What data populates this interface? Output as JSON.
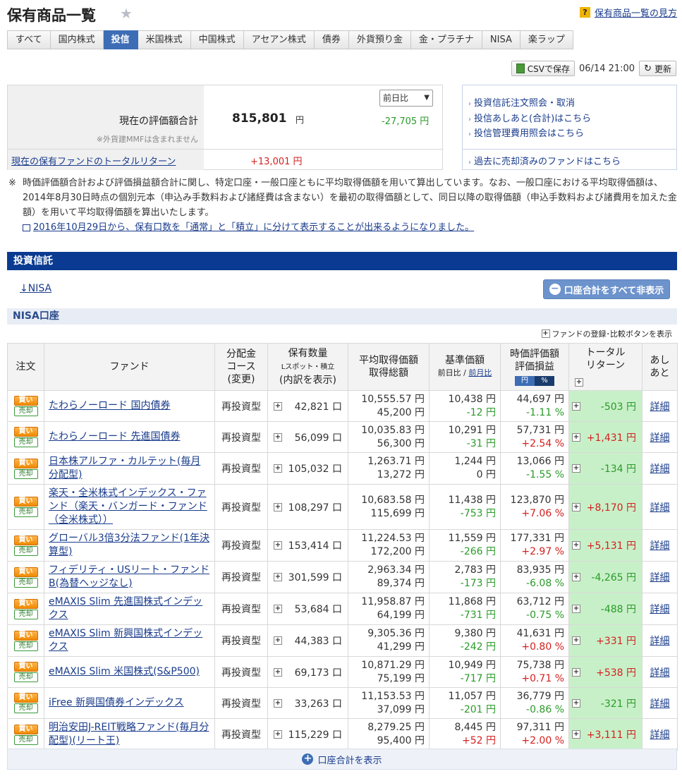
{
  "header": {
    "title": "保有商品一覧",
    "help_link": "保有商品一覧の見方"
  },
  "tabs": [
    {
      "label": "すべて"
    },
    {
      "label": "国内株式"
    },
    {
      "label": "投信"
    },
    {
      "label": "米国株式"
    },
    {
      "label": "中国株式"
    },
    {
      "label": "アセアン株式"
    },
    {
      "label": "債券"
    },
    {
      "label": "外貨預り金"
    },
    {
      "label": "金・プラチナ"
    },
    {
      "label": "NISA"
    },
    {
      "label": "楽ラップ"
    }
  ],
  "active_tab": "投信",
  "toolbar": {
    "csv_label": "CSVで保存",
    "timestamp": "06/14 21:00",
    "refresh_label": "更新"
  },
  "summary": {
    "valuation_label": "現在の評価額合計",
    "valuation_note": "※外貨建MMFは含まれません",
    "valuation_amount": "815,801",
    "yen": "円",
    "compare_select": "前日比",
    "diff": "-27,705 円",
    "total_return_label": "現在の保有ファンドのトータルリターン",
    "total_return_value": "+13,001 円"
  },
  "side_links": {
    "link1": "投資信託注文照会・取消",
    "link2": "投信あしあと(合計)はこちら",
    "link3": "投信管理費用照会はこちら",
    "link4": "過去に売却済みのファンドはこちら"
  },
  "notes": {
    "mark": "※",
    "text": "時価評価額合計および評価損益額合計に関し、特定口座・一般口座ともに平均取得価額を用いて算出しています。なお、一般口座における平均取得価額は、2014年8月30日時点の個別元本（申込み手数料および諸経費は含まない）を最初の取得価額として、同日以降の取得価額（申込手数料および諸費用を加えた金額）を用いて平均取得価額を算出いたします。",
    "news_link": "2016年10月29日から、保有口数を「通常」と「積立」に分けて表示することが出来るようになりました。"
  },
  "section": {
    "title": "投資信託",
    "nisa_anchor": "↓NISA",
    "hide_button": "口座合計をすべて非表示",
    "subsection": "NISA口座",
    "fund_register": "ファンドの登録･比較ボタンを表示"
  },
  "table": {
    "headers": {
      "order": "注文",
      "fund": "ファンド",
      "course_l1": "分配金",
      "course_l2": "コース",
      "course_l3": "(変更)",
      "qty_l1": "保有数量",
      "qty_l2": "Lスポット・積立",
      "qty_l3": "(内訳を表示)",
      "avg_l1": "平均取得価額",
      "avg_l2": "取得総額",
      "base_l1": "基準価額",
      "base_l2a": "前日比",
      "base_l2b": "前月比",
      "val_l1": "時価評価額",
      "val_l2": "評価損益",
      "toggle_yen": "円",
      "toggle_pct": "%",
      "ret_l1": "トータル",
      "ret_l2": "リターン",
      "ash_l1": "あし",
      "ash_l2": "あと"
    },
    "buy_label": "買い",
    "sell_label": "売却",
    "detail_label": "詳細",
    "rows": [
      {
        "fund": "たわらノーロード 国内債券",
        "course": "再投資型",
        "qty": "42,821 口",
        "avg": "10,555.57 円",
        "cost": "45,200 円",
        "base": "10,438 円",
        "base_diff": "-12 円",
        "value": "44,697 円",
        "pnl": "-1.11 %",
        "ret": "-503 円"
      },
      {
        "fund": "たわらノーロード 先進国債券",
        "course": "再投資型",
        "qty": "56,099 口",
        "avg": "10,035.83 円",
        "cost": "56,300 円",
        "base": "10,291 円",
        "base_diff": "-31 円",
        "value": "57,731 円",
        "pnl": "+2.54 %",
        "ret": "+1,431 円"
      },
      {
        "fund": "日本株アルファ・カルテット(毎月分配型)",
        "course": "再投資型",
        "qty": "105,032 口",
        "avg": "1,263.71 円",
        "cost": "13,272 円",
        "base": "1,244 円",
        "base_diff": "0 円",
        "value": "13,066 円",
        "pnl": "-1.55 %",
        "ret": "-134 円"
      },
      {
        "fund": "楽天・全米株式インデックス・ファンド（楽天・バンガード・ファンド（全米株式））",
        "course": "再投資型",
        "qty": "108,297 口",
        "avg": "10,683.58 円",
        "cost": "115,699 円",
        "base": "11,438 円",
        "base_diff": "-753 円",
        "value": "123,870 円",
        "pnl": "+7.06 %",
        "ret": "+8,170 円"
      },
      {
        "fund": "グローバル3倍3分法ファンド(1年決算型)",
        "course": "再投資型",
        "qty": "153,414 口",
        "avg": "11,224.53 円",
        "cost": "172,200 円",
        "base": "11,559 円",
        "base_diff": "-266 円",
        "value": "177,331 円",
        "pnl": "+2.97 %",
        "ret": "+5,131 円"
      },
      {
        "fund": "フィデリティ・USリート・ファンドB(為替ヘッジなし)",
        "course": "再投資型",
        "qty": "301,599 口",
        "avg": "2,963.34 円",
        "cost": "89,374 円",
        "base": "2,783 円",
        "base_diff": "-173 円",
        "value": "83,935 円",
        "pnl": "-6.08 %",
        "ret": "-4,265 円"
      },
      {
        "fund": "eMAXIS Slim 先進国株式インデックス",
        "course": "再投資型",
        "qty": "53,684 口",
        "avg": "11,958.87 円",
        "cost": "64,199 円",
        "base": "11,868 円",
        "base_diff": "-731 円",
        "value": "63,712 円",
        "pnl": "-0.75 %",
        "ret": "-488 円"
      },
      {
        "fund": "eMAXIS Slim 新興国株式インデックス",
        "course": "再投資型",
        "qty": "44,383 口",
        "avg": "9,305.36 円",
        "cost": "41,299 円",
        "base": "9,380 円",
        "base_diff": "-242 円",
        "value": "41,631 円",
        "pnl": "+0.80 %",
        "ret": "+331 円"
      },
      {
        "fund": "eMAXIS Slim 米国株式(S&P500)",
        "course": "再投資型",
        "qty": "69,173 口",
        "avg": "10,871.29 円",
        "cost": "75,199 円",
        "base": "10,949 円",
        "base_diff": "-717 円",
        "value": "75,738 円",
        "pnl": "+0.71 %",
        "ret": "+538 円"
      },
      {
        "fund": "iFree 新興国債券インデックス",
        "course": "再投資型",
        "qty": "33,263 口",
        "avg": "11,153.53 円",
        "cost": "37,099 円",
        "base": "11,057 円",
        "base_diff": "-201 円",
        "value": "36,779 円",
        "pnl": "-0.86 %",
        "ret": "-321 円"
      },
      {
        "fund": "明治安田J-REIT戦略ファンド(毎月分配型)(リート王)",
        "course": "再投資型",
        "qty": "115,229 口",
        "avg": "8,279.25 円",
        "cost": "95,400 円",
        "base": "8,445 円",
        "base_diff": "+52 円",
        "value": "97,311 円",
        "pnl": "+2.00 %",
        "ret": "+3,111 円"
      }
    ]
  },
  "footer": {
    "show_total": "口座合計を表示"
  },
  "colors": {
    "accent": "#0a3a91",
    "tab_active": "#3d6db5",
    "positive": "#d42020",
    "negative": "#2a9a2a",
    "return_bg": "#c8f0c8"
  }
}
